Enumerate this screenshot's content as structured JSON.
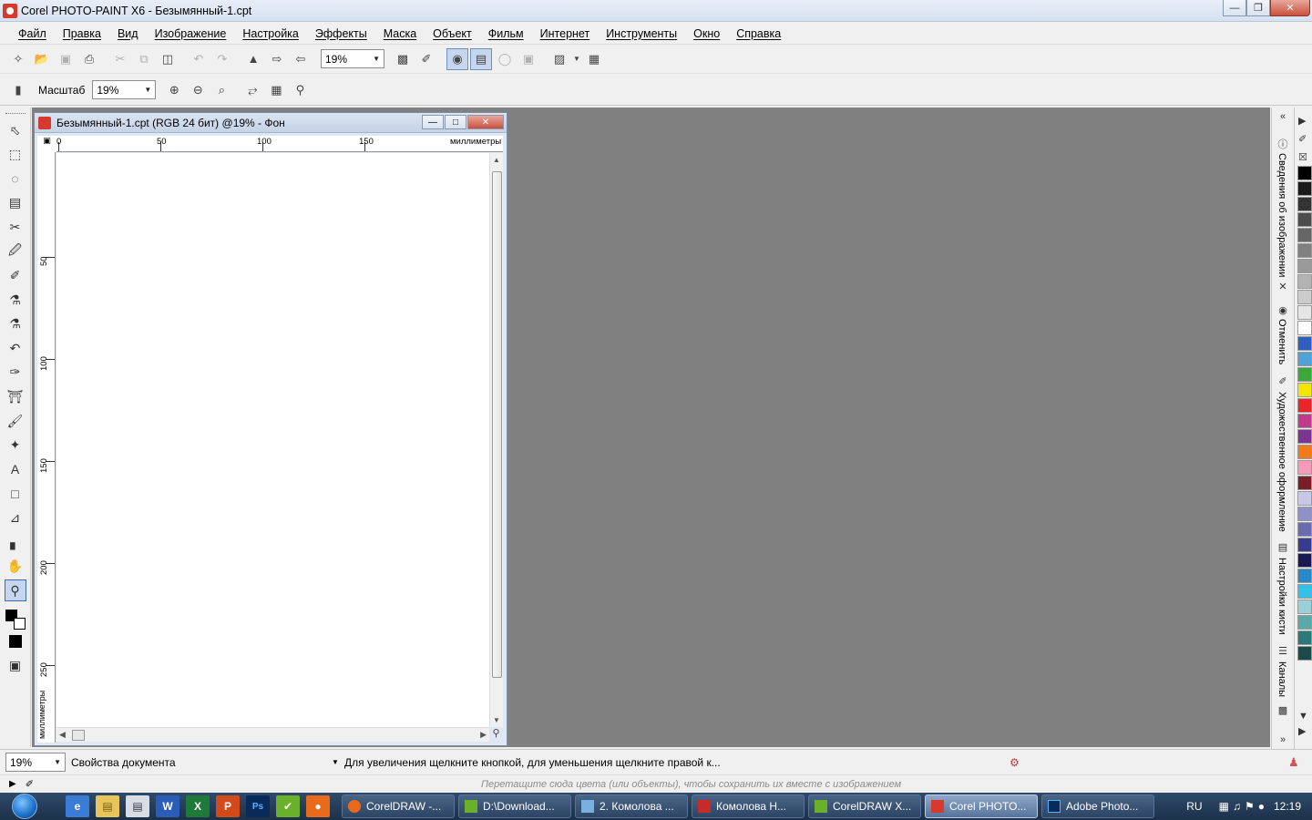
{
  "window": {
    "title": "Corel PHOTO-PAINT X6 - Безымянный-1.cpt"
  },
  "menu": [
    "Файл",
    "Правка",
    "Вид",
    "Изображение",
    "Настройка",
    "Эффекты",
    "Маска",
    "Объект",
    "Фильм",
    "Интернет",
    "Инструменты",
    "Окно",
    "Справка"
  ],
  "toolbar": {
    "zoom_value": "19%"
  },
  "property_bar": {
    "zoom_label": "Масштаб",
    "zoom_value": "19%"
  },
  "document": {
    "title": "Безымянный-1.cpt (RGB 24 бит) @19% - Фон",
    "ruler_h": {
      "ticks": [
        "0",
        "50",
        "100",
        "150"
      ],
      "unit": "миллиметры"
    },
    "ruler_v": {
      "ticks": [
        "50",
        "100",
        "150",
        "200",
        "250"
      ],
      "unit": "миллиметры"
    }
  },
  "dockers": [
    "Сведения об изображении",
    "Отменить",
    "Художественное оформление",
    "Настройки кисти",
    "Каналы"
  ],
  "palette_colors": [
    "#000000",
    "#1a1a1a",
    "#333333",
    "#4d4d4d",
    "#666666",
    "#808080",
    "#999999",
    "#b3b3b3",
    "#cccccc",
    "#e6e6e6",
    "#ffffff",
    "#2e5fbf",
    "#4fa3d9",
    "#3aa83a",
    "#f2e600",
    "#e8262a",
    "#c23a8c",
    "#7a3590",
    "#f07a1a",
    "#f29ab8",
    "#7a1f2a",
    "#c8c8e6",
    "#9090c8",
    "#6a6ab0",
    "#3a3a90",
    "#1a1a50",
    "#2a88c8",
    "#36c0e8",
    "#9ad0d8",
    "#5aa8a8",
    "#2a7a7a",
    "#1a4a4a"
  ],
  "status": {
    "zoom": "19%",
    "doc_props": "Свойства документа",
    "message": "Для увеличения щелкните кнопкой, для уменьшения щелкните правой к...",
    "hint": "Перетащите сюда цвета (или объекты), чтобы сохранить их вместе с изображением"
  },
  "taskbar": {
    "tasks": [
      "CorelDRAW -...",
      "D:\\Download...",
      "2. Комолова ...",
      "Комолова Н...",
      "CorelDRAW X...",
      "Corel PHOTO...",
      "Adobe Photo..."
    ],
    "lang": "RU",
    "clock": "12:19"
  }
}
